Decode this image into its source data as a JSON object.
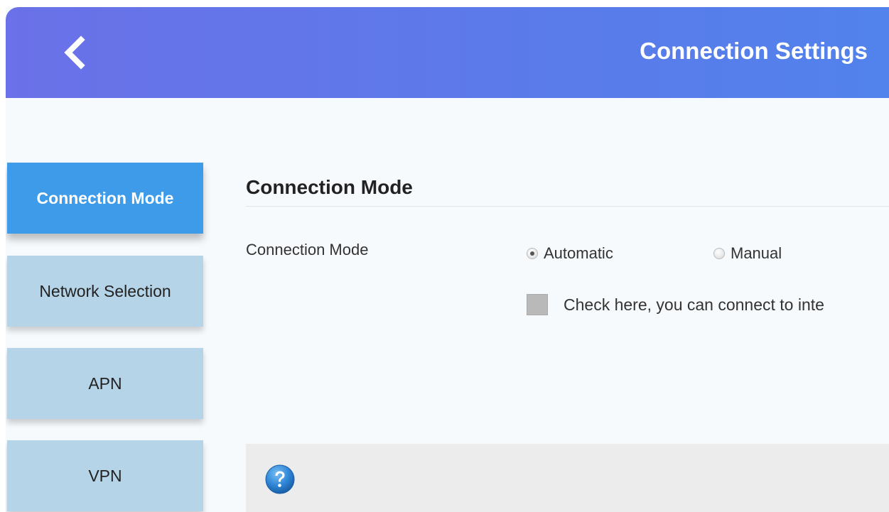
{
  "header": {
    "title": "Connection Settings",
    "back_icon": "chevron-left-icon"
  },
  "sidebar": {
    "items": [
      {
        "label": "Connection Mode",
        "active": true
      },
      {
        "label": "Network Selection",
        "active": false
      },
      {
        "label": "APN",
        "active": false
      },
      {
        "label": "VPN",
        "active": false
      }
    ]
  },
  "main": {
    "section_title": "Connection Mode",
    "field_label": "Connection Mode",
    "options": [
      {
        "label": "Automatic",
        "selected": true
      },
      {
        "label": "Manual",
        "selected": false
      }
    ],
    "checkbox_text": "Check here, you can connect to inte",
    "checkbox_checked": false
  },
  "help": {
    "icon": "question-icon"
  },
  "colors": {
    "header_start": "#6b71e8",
    "header_end": "#5282ec",
    "sidebar_active": "#3d9be9",
    "sidebar_inactive": "#b6d4e8",
    "help_icon": "#2f86d6"
  }
}
